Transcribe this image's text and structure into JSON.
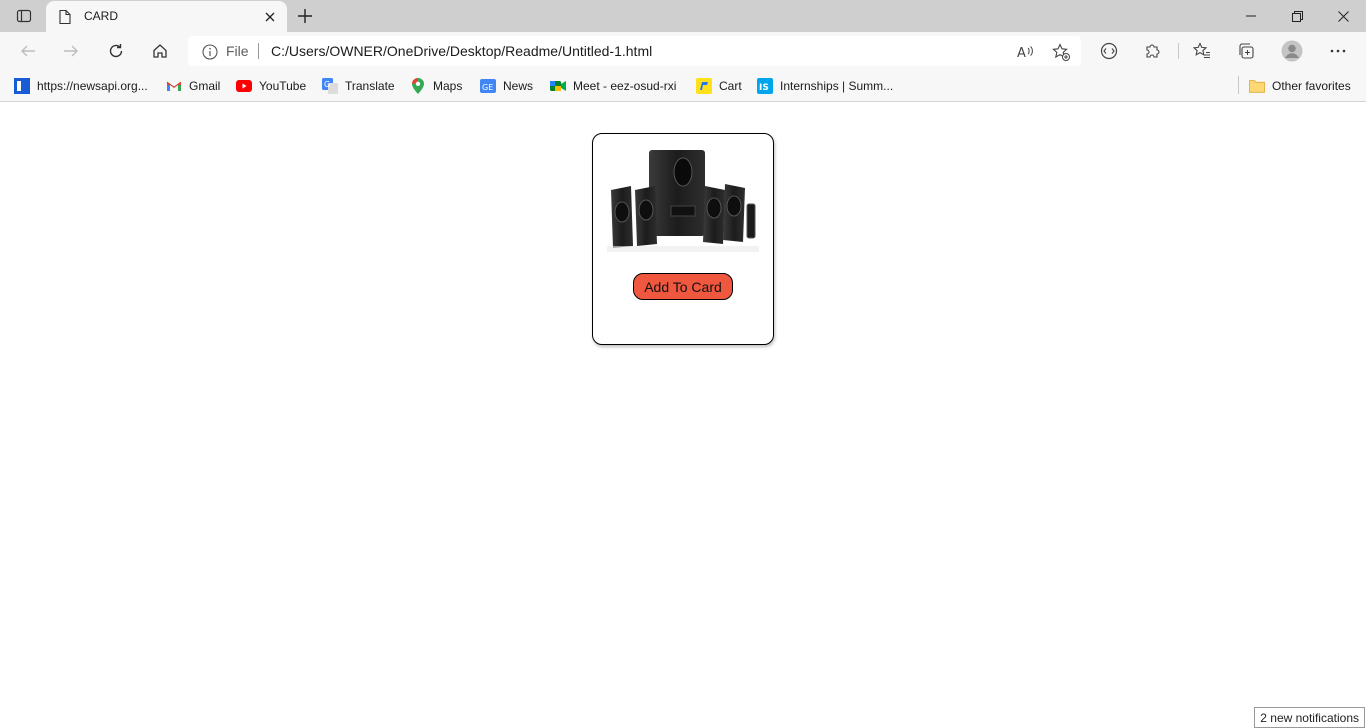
{
  "tab": {
    "title": "CARD"
  },
  "address_bar": {
    "scheme": "File",
    "url": "C:/Users/OWNER/OneDrive/Desktop/Readme/Untitled-1.html"
  },
  "bookmarks": [
    {
      "label": "https://newsapi.org...",
      "icon": "newsapi-icon"
    },
    {
      "label": "Gmail",
      "icon": "gmail-icon"
    },
    {
      "label": "YouTube",
      "icon": "youtube-icon"
    },
    {
      "label": "Translate",
      "icon": "translate-icon"
    },
    {
      "label": "Maps",
      "icon": "maps-icon"
    },
    {
      "label": "News",
      "icon": "news-icon"
    },
    {
      "label": "Meet - eez-osud-rxi",
      "icon": "meet-icon"
    },
    {
      "label": "Cart",
      "icon": "cart-icon"
    },
    {
      "label": "Internships | Summ...",
      "icon": "internshala-icon"
    }
  ],
  "other_favorites": {
    "label": "Other favorites"
  },
  "card": {
    "image": "speaker-system-image",
    "button_label": "Add To Card",
    "button_color": "#f0573f"
  },
  "notifications": {
    "label": "2 new notifications"
  }
}
